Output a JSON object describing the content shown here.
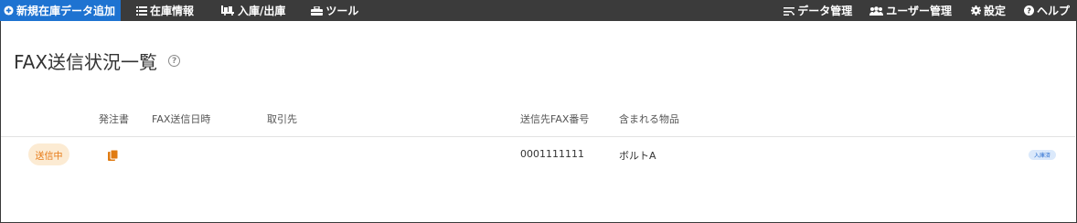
{
  "nav": {
    "primary_label": "新規在庫データ追加",
    "items": [
      {
        "label": "在庫情報",
        "icon": "list-icon"
      },
      {
        "label": "入庫/出庫",
        "icon": "truck-icon"
      },
      {
        "label": "ツール",
        "icon": "toolbox-icon"
      }
    ],
    "right_items": [
      {
        "label": "データ管理",
        "icon": "data-manage-icon"
      },
      {
        "label": "ユーザー管理",
        "icon": "users-icon"
      },
      {
        "label": "設定",
        "icon": "gear-icon"
      },
      {
        "label": "ヘルプ",
        "icon": "help-icon"
      }
    ]
  },
  "page": {
    "title": "FAX送信状況一覧"
  },
  "table": {
    "headers": {
      "order": "発注書",
      "fax_datetime": "FAX送信日時",
      "supplier": "取引先",
      "fax_number": "送信先FAX番号",
      "items": "含まれる物品"
    },
    "rows": [
      {
        "status": "送信中",
        "fax_datetime": "",
        "supplier": "",
        "fax_number": "0001111111",
        "items": "ボルトA",
        "tag": "入庫済"
      }
    ]
  },
  "colors": {
    "nav_bg": "#3b3b3b",
    "primary": "#1e73d1",
    "status_bg": "#fcebd3",
    "status_text": "#e67a16",
    "doc_icon": "#e07b12"
  }
}
